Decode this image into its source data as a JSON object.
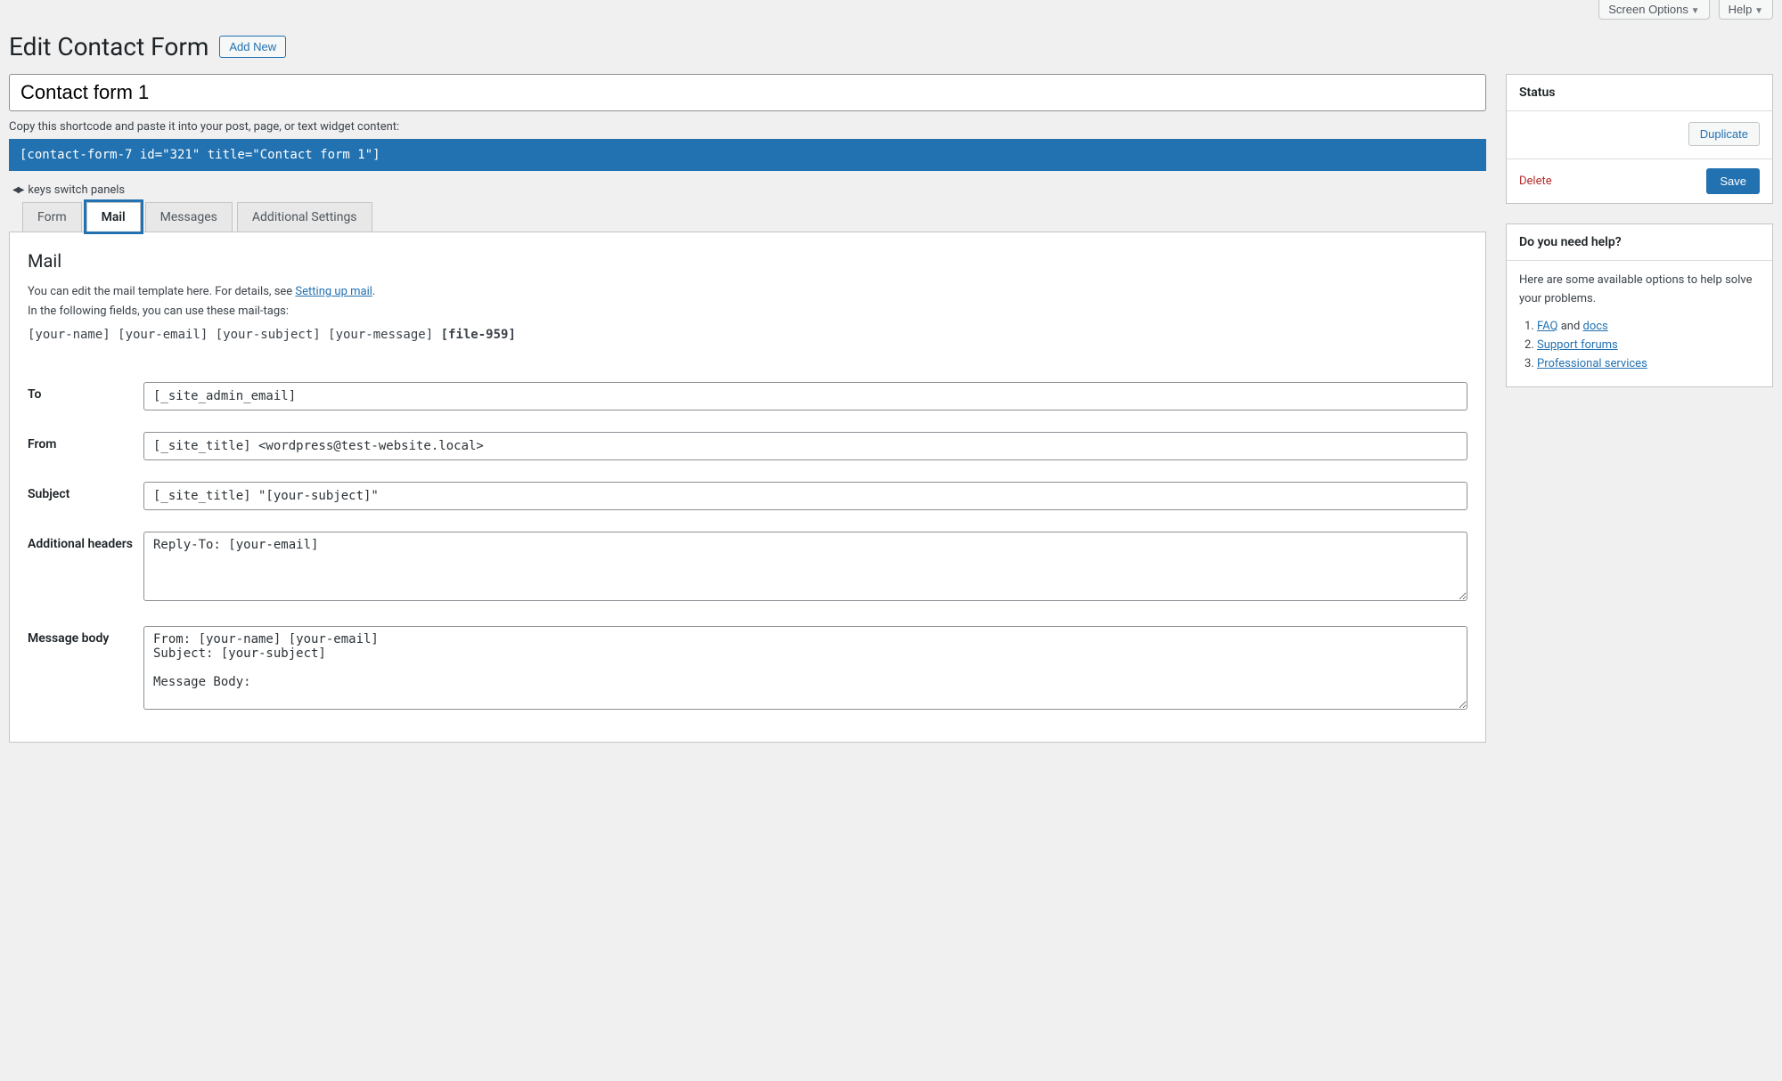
{
  "top": {
    "screen_options": "Screen Options",
    "help": "Help"
  },
  "header": {
    "title": "Edit Contact Form",
    "add_new": "Add New"
  },
  "form": {
    "title_value": "Contact form 1",
    "shortcode_hint": "Copy this shortcode and paste it into your post, page, or text widget content:",
    "shortcode": "[contact-form-7 id=\"321\" title=\"Contact form 1\"]",
    "switch_note": "keys switch panels"
  },
  "tabs": {
    "form": "Form",
    "mail": "Mail",
    "messages": "Messages",
    "additional": "Additional Settings"
  },
  "mail": {
    "heading": "Mail",
    "hint_a": "You can edit the mail template here. For details, see ",
    "hint_link": "Setting up mail",
    "hint_b": ".",
    "hint_c": "In the following fields, you can use these mail-tags:",
    "tags": "[your-name] [your-email] [your-subject] [your-message]",
    "bold_tag": "[file-959]",
    "labels": {
      "to": "To",
      "from": "From",
      "subject": "Subject",
      "additional_headers": "Additional headers",
      "message_body": "Message body"
    },
    "values": {
      "to": "[_site_admin_email]",
      "from": "[_site_title] <wordpress@test-website.local>",
      "subject": "[_site_title] \"[your-subject]\"",
      "additional_headers": "Reply-To: [your-email]",
      "message_body": "From: [your-name] [your-email]\nSubject: [your-subject]\n\nMessage Body:"
    }
  },
  "status": {
    "heading": "Status",
    "duplicate": "Duplicate",
    "delete": "Delete",
    "save": "Save"
  },
  "helpbox": {
    "heading": "Do you need help?",
    "text": "Here are some available options to help solve your problems.",
    "items": {
      "faq": "FAQ",
      "and": " and ",
      "docs": "docs",
      "forums": "Support forums",
      "pro": "Professional services"
    }
  }
}
